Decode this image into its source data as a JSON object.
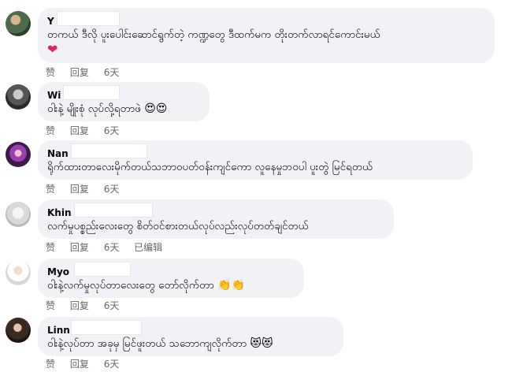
{
  "comments": [
    {
      "name": "Y",
      "text": "တကယ် ဒီလို ပူးပေါင်းဆောင်ရွက်တဲ့ ကဏ္ဍတွေ ဒီထက်မက တိုးတက်လာရင်ကောင်းမယ်",
      "emoji": "❤",
      "actions": {
        "like": "赞",
        "reply": "回复",
        "time": "6天"
      }
    },
    {
      "name": "Wi",
      "text": "ဝါးနဲ့ မျိုးစုံ လုပ်လို့ရတာဖဲ",
      "emoji": "😍😍",
      "actions": {
        "like": "赞",
        "reply": "回复",
        "time": "6天"
      }
    },
    {
      "name": "Nan",
      "text": "ရိုက်ထားတာလေးမိုက်တယ်သဘာဝပတ်ဝန်းကျင်ကော လူနေမှုဘဝပါ ပူးတွဲ မြင်ရတယ်",
      "emoji": "",
      "actions": {
        "like": "赞",
        "reply": "回复",
        "time": "6天"
      }
    },
    {
      "name": "Khin",
      "text": "လက်မှုပစ္စည်းလေးတွေ စိတ်ဝင်စားတယ်လုပ်လည်းလုပ်တတ်ချင်တယ်",
      "emoji": "",
      "actions": {
        "like": "赞",
        "reply": "回复",
        "time": "6天",
        "edited": "已编辑"
      }
    },
    {
      "name": "Myo",
      "text": "ဝါးနဲ့လက်မှုလုပ်တာလေးတွေ တော်လိုက်တာ",
      "emoji": "👏👏",
      "actions": {
        "like": "赞",
        "reply": "回复",
        "time": "6天"
      }
    },
    {
      "name": "Linn",
      "text": "ဝါးနဲ့လုပ်တာ အခုမှ မြင်ဖူးတယ် သဘောကျလိုက်တာ",
      "emoji": "😻😻",
      "actions": {
        "like": "赞",
        "reply": "回复",
        "time": "6天"
      }
    }
  ]
}
